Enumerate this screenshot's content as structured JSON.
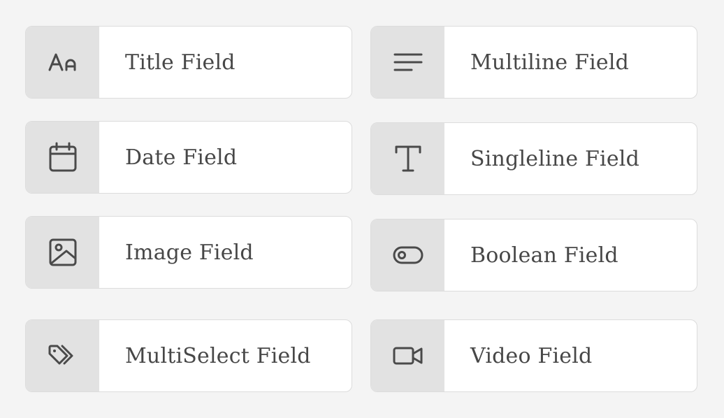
{
  "fields": [
    {
      "label": "Title Field",
      "icon": "title-type-icon"
    },
    {
      "label": "Multiline Field",
      "icon": "multiline-icon"
    },
    {
      "label": "Date Field",
      "icon": "calendar-icon"
    },
    {
      "label": "Singleline Field",
      "icon": "text-t-icon"
    },
    {
      "label": "Image Field",
      "icon": "image-icon"
    },
    {
      "label": "Boolean Field",
      "icon": "toggle-icon"
    },
    {
      "label": "MultiSelect Field",
      "icon": "tags-icon"
    },
    {
      "label": "Video Field",
      "icon": "video-camera-icon"
    }
  ],
  "colors": {
    "background": "#f4f4f4",
    "card": "#ffffff",
    "icon_panel": "#e2e2e2",
    "border": "#dcdcdc",
    "text": "#474747",
    "icon": "#4a4a4a"
  }
}
